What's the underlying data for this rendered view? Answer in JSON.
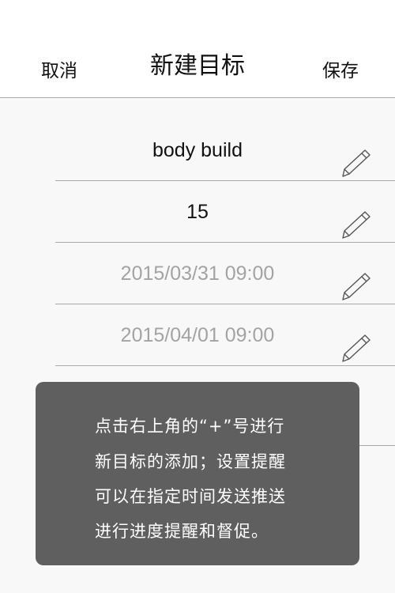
{
  "nav": {
    "cancel_label": "取消",
    "title": "新建目标",
    "save_label": "保存"
  },
  "form": {
    "rows": [
      {
        "value": "body build"
      },
      {
        "value": "15"
      },
      {
        "value": "2015/03/31 09:00"
      },
      {
        "value": "2015/04/01 09:00"
      }
    ],
    "edit_icon": "pencil-icon"
  },
  "tooltip": {
    "lines": [
      "点击右上角的“+”号进行",
      "新目标的添加；设置提醒",
      "可以在指定时间发送推送",
      "进行进度提醒和督促。"
    ]
  },
  "colors": {
    "nav_background": "#ffffff",
    "page_background": "#f8f8f8",
    "divider": "#a9a9a9",
    "placeholder_text": "#a3a3a3",
    "tooltip_background": "#5f5f5f"
  }
}
